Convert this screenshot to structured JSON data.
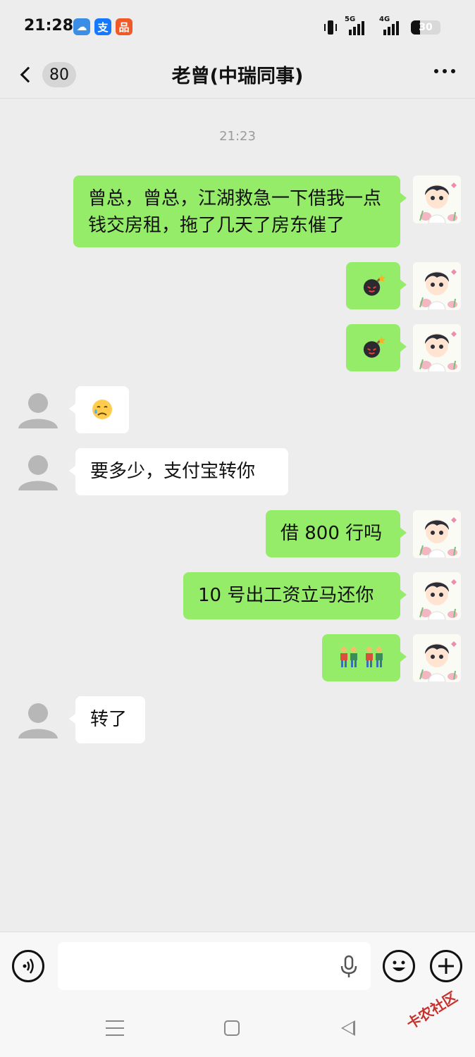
{
  "status_bar": {
    "time": "21:28",
    "app_icons": [
      {
        "name": "weather-app-icon",
        "glyph": "☁",
        "color": "#3a8ee6"
      },
      {
        "name": "alipay-app-icon",
        "glyph": "支",
        "color": "#1677ff"
      },
      {
        "name": "shopping-app-icon",
        "glyph": "品",
        "color": "#f05a28"
      }
    ],
    "signal_1_label": "5G",
    "signal_2_label": "4G",
    "battery_level": "30",
    "battery_fraction": 0.3
  },
  "header": {
    "unread_count": "80",
    "title": "老曾(中瑞同事)"
  },
  "chat": {
    "timestamp": "21:23",
    "messages": [
      {
        "side": "self",
        "text": "曾总，曾总，江湖救急一下借我一点钱交房租，拖了几天了房东催了"
      },
      {
        "side": "self",
        "emoji": "bomb-emoji"
      },
      {
        "side": "self",
        "emoji": "bomb-emoji"
      },
      {
        "side": "other",
        "emoji": "sad-sweat-emoji"
      },
      {
        "side": "other",
        "text": "要多少，支付宝转你"
      },
      {
        "side": "self",
        "text": "借 800 行吗"
      },
      {
        "side": "self",
        "text": "10 号出工资立马还你"
      },
      {
        "side": "self",
        "emoji": "two-people-emoji-pair"
      },
      {
        "side": "other",
        "text": "转了"
      }
    ]
  },
  "input": {
    "placeholder": ""
  },
  "colors": {
    "self_bubble": "#95ec69",
    "other_bubble": "#ffffff",
    "background": "#ededed"
  },
  "watermark": "卡农社区"
}
